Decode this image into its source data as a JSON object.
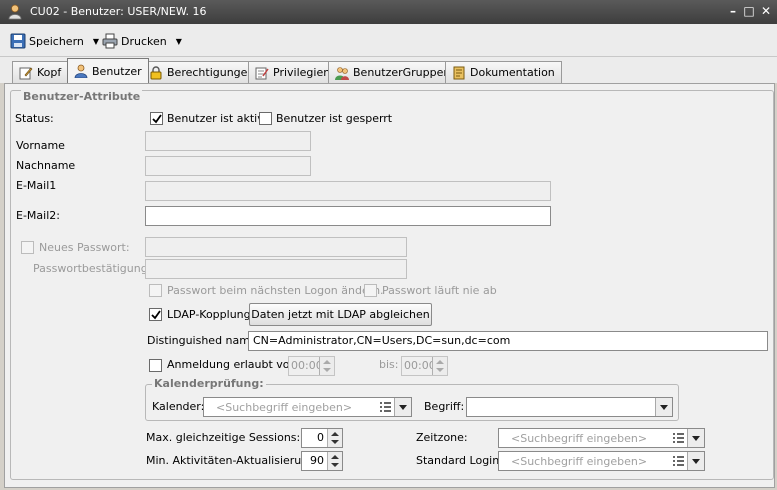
{
  "window": {
    "title": "CU02 - Benutzer: USER/NEW. 16",
    "minimize": "–",
    "maximize": "□",
    "close": "✕"
  },
  "toolbar": {
    "save_label": "Speichern",
    "print_label": "Drucken"
  },
  "tabs": [
    {
      "label": "Kopf",
      "icon": "edit-icon"
    },
    {
      "label": "Benutzer",
      "icon": "user-icon"
    },
    {
      "label": "Berechtigungen",
      "icon": "lock-icon"
    },
    {
      "label": "Privilegien",
      "icon": "privilege-icon"
    },
    {
      "label": "BenutzerGruppen",
      "icon": "group-icon"
    },
    {
      "label": "Dokumentation",
      "icon": "document-icon"
    }
  ],
  "active_tab": "Benutzer",
  "form": {
    "group_title": "Benutzer-Attribute",
    "status_label": "Status:",
    "aktiv_label": "Benutzer ist aktiv",
    "aktiv_checked": true,
    "gesperrt_label": "Benutzer ist gesperrt",
    "gesperrt_checked": false,
    "vorname_label": "Vorname",
    "vorname_value": "",
    "nachname_label": "Nachname",
    "nachname_value": "",
    "email1_label": "E-Mail1",
    "email1_value": "",
    "email2_label": "E-Mail2:",
    "email2_value": "",
    "neues_passwort_label": "Neues Passwort:",
    "passwort_bestaetigung_label": "Passwortbestätigung:",
    "pw_change_label": "Passwort beim nächsten Logon ändern.",
    "pw_never_expires_label": "Passwort läuft nie ab",
    "ldap_label": "LDAP-Kopplung",
    "ldap_checked": true,
    "ldap_sync_button": "Daten jetzt mit LDAP abgleichen",
    "dn_label": "Distinguished name:",
    "dn_value": "CN=Administrator,CN=Users,DC=sun,dc=com",
    "login_allowed_label": "Anmeldung erlaubt von:",
    "login_allowed_checked": false,
    "time_from": "00:00",
    "bis_label": "bis:",
    "time_to": "00:00",
    "kalender_group_title": "Kalenderprüfung:",
    "kalender_label": "Kalender:",
    "kalender_placeholder": "<Suchbegriff eingeben>",
    "begriff_label": "Begriff:",
    "begriff_value": "",
    "max_sessions_label": "Max. gleichzeitige Sessions:",
    "max_sessions_value": "0",
    "min_activity_label": "Min. Aktivitäten-Aktualisierung:",
    "min_activity_value": "90",
    "zeitzone_label": "Zeitzone:",
    "zeitzone_placeholder": "<Suchbegriff eingeben>",
    "standard_login_label": "Standard Login:",
    "standard_login_placeholder": "<Suchbegriff eingeben>"
  }
}
